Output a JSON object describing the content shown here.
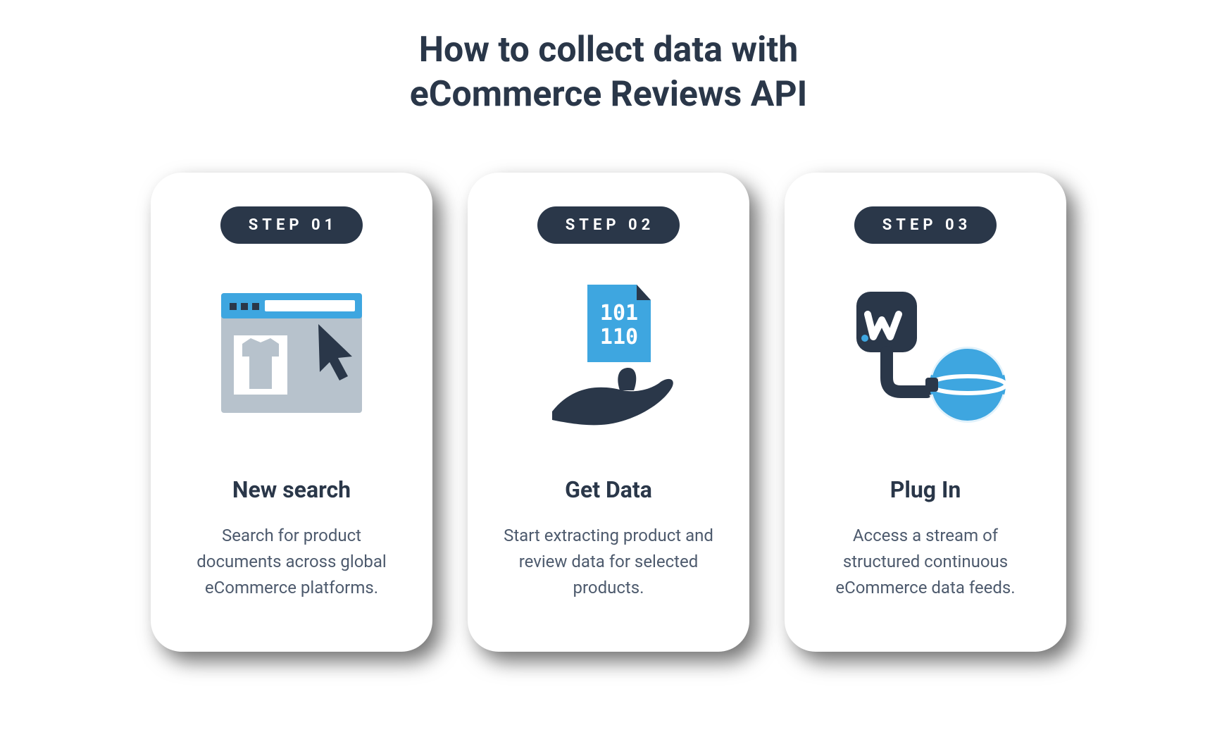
{
  "title_line1": "How to collect data with",
  "title_line2": "eCommerce Reviews API",
  "steps": [
    {
      "badge": "STEP 01",
      "title": "New search",
      "desc": "Search for product documents across global eCommerce platforms."
    },
    {
      "badge": "STEP 02",
      "title": "Get Data",
      "desc": "Start extracting product and review data for selected products."
    },
    {
      "badge": "STEP 03",
      "title": "Plug In",
      "desc": "Access a stream of structured continuous eCommerce data feeds."
    }
  ],
  "colors": {
    "dark": "#2a3749",
    "blue": "#3ea6e0",
    "gray": "#b7c2cc",
    "white": "#ffffff"
  }
}
